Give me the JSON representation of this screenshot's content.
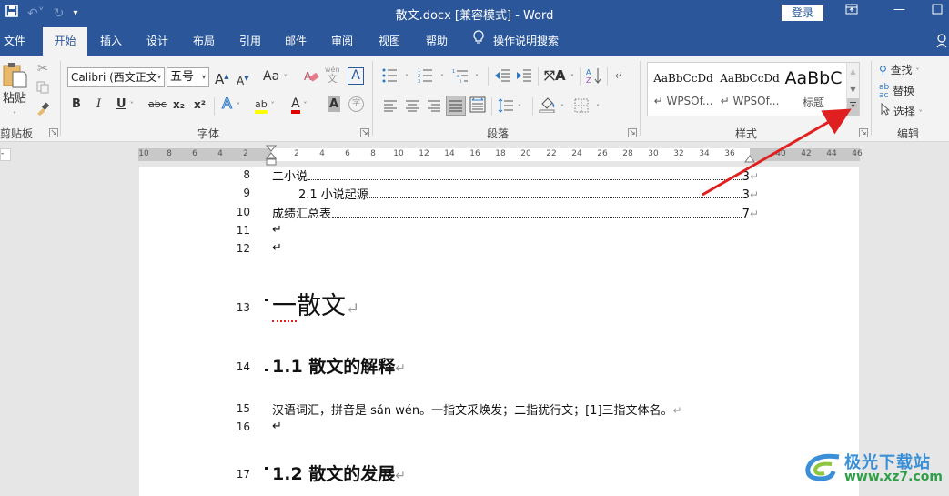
{
  "window": {
    "title": "散文.docx [兼容模式]  -  Word",
    "login_label": "登录",
    "quick_access": {
      "save_icon": "save-icon",
      "undo_icon": "undo-icon",
      "redo_icon": "redo-icon",
      "customize_icon": "customize-qat-icon"
    },
    "controls": [
      "ribbon-display-options",
      "minimize",
      "maximize"
    ]
  },
  "tabs": [
    {
      "label": "文件",
      "active": false
    },
    {
      "label": "开始",
      "active": true
    },
    {
      "label": "插入",
      "active": false
    },
    {
      "label": "设计",
      "active": false
    },
    {
      "label": "布局",
      "active": false
    },
    {
      "label": "引用",
      "active": false
    },
    {
      "label": "邮件",
      "active": false
    },
    {
      "label": "审阅",
      "active": false
    },
    {
      "label": "视图",
      "active": false
    },
    {
      "label": "帮助",
      "active": false
    }
  ],
  "tell_me": {
    "label": "操作说明搜索"
  },
  "ribbon": {
    "clipboard": {
      "label": "剪贴板",
      "paste_label": "粘贴",
      "cut": "cut-icon",
      "copy": "copy-icon",
      "format_painter": "format-painter-icon"
    },
    "font": {
      "label": "字体",
      "font_name": "Calibri (西文正文",
      "font_size": "五号",
      "grow": "A",
      "shrink": "A",
      "change_case": "Aa",
      "bold": "B",
      "italic": "I",
      "underline": "U",
      "strikethrough": "abc",
      "subscript": "x₂",
      "superscript": "x²",
      "text_effects": "A",
      "highlight": "ab",
      "font_color": "A",
      "char_shading": "A",
      "enclose": "字",
      "phonetic": "wén",
      "phonetic_char": "文",
      "char_border": "A",
      "font_color_hex": "#e00000",
      "highlight_hex": "#ffff00"
    },
    "paragraph": {
      "label": "段落"
    },
    "styles": {
      "label": "样式",
      "items": [
        {
          "sample": "AaBbCcDd",
          "name": "↵ WPSOf..."
        },
        {
          "sample": "AaBbCcDd",
          "name": "↵ WPSOf..."
        },
        {
          "sample": "AaBbC",
          "name": "标题"
        }
      ]
    },
    "editing": {
      "label": "编辑",
      "find": "查找",
      "replace": "替换",
      "select": "选择"
    }
  },
  "ruler": {
    "left_ticks": [
      "10",
      "8",
      "6",
      "4",
      "2"
    ],
    "right_ticks": [
      "2",
      "4",
      "6",
      "8",
      "10",
      "12",
      "14",
      "16",
      "18",
      "20",
      "22",
      "24",
      "26",
      "28",
      "30",
      "32",
      "34",
      "36",
      "",
      "40",
      "42",
      "44",
      "46"
    ]
  },
  "document": {
    "toc": [
      {
        "line": "8",
        "text": "二小说",
        "page": "3"
      },
      {
        "line": "9",
        "text": "2.1 小说起源",
        "page": "3"
      },
      {
        "line": "10",
        "text": "成绩汇总表",
        "page": "7"
      }
    ],
    "empty_lines": [
      "11",
      "12"
    ],
    "heading1": {
      "line": "13",
      "text": "一散文",
      "squiggle_part": "一"
    },
    "heading2_a": {
      "line": "14",
      "text": "1.1 散文的解释"
    },
    "body": {
      "line": "15",
      "text": "汉语词汇，拼音是 sǎn wén。一指文采焕发；二指犹行文；[1]三指文体名。"
    },
    "empty_line_16": "16",
    "heading2_b": {
      "line": "17",
      "text": "1.2 散文的发展"
    },
    "para_mark": "↵"
  },
  "watermark": {
    "title": "极光下载站",
    "url": "www.xz7.com"
  },
  "annotation": {
    "arrow_color": "#e02020"
  }
}
